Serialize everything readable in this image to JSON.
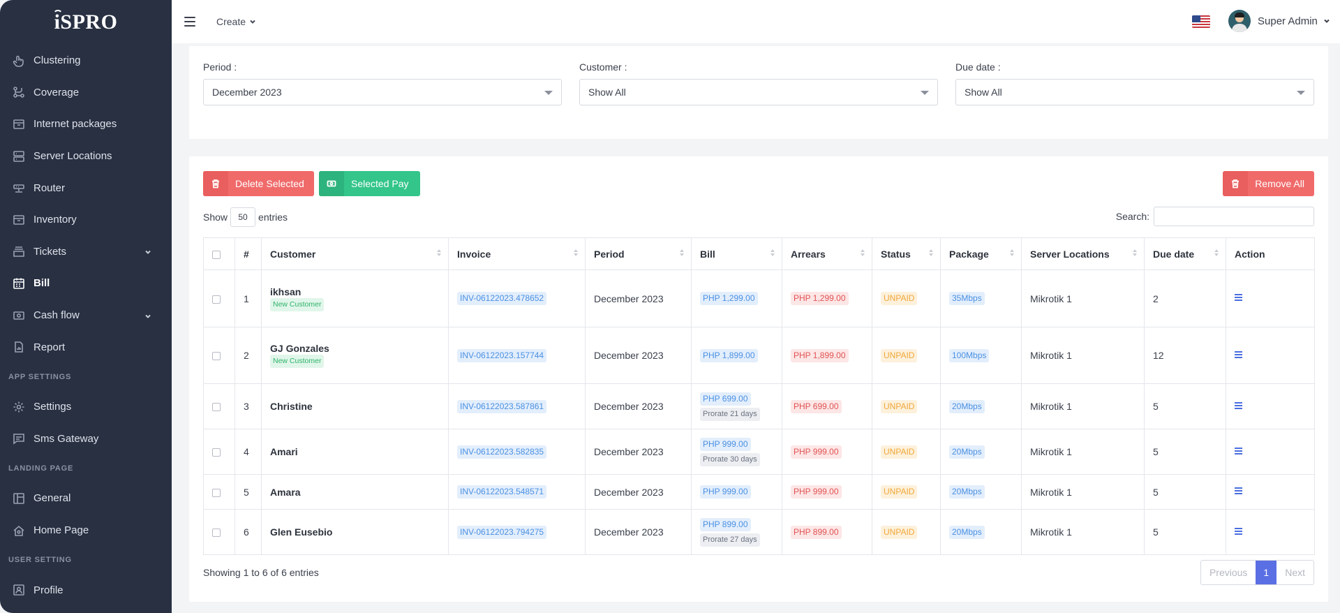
{
  "brand": {
    "name": "iSPRO"
  },
  "sidebar": {
    "items": [
      {
        "label": "Clustering",
        "icon": "hand-icon"
      },
      {
        "label": "Coverage",
        "icon": "route-icon"
      },
      {
        "label": "Internet packages",
        "icon": "archive-icon"
      },
      {
        "label": "Server Locations",
        "icon": "server-icon"
      },
      {
        "label": "Router",
        "icon": "router-icon"
      },
      {
        "label": "Inventory",
        "icon": "archive-icon"
      },
      {
        "label": "Tickets",
        "icon": "ticket-icon",
        "has_submenu": true
      },
      {
        "label": "Bill",
        "icon": "calendar-icon",
        "active": true
      },
      {
        "label": "Cash flow",
        "icon": "cash-icon",
        "has_submenu": true
      },
      {
        "label": "Report",
        "icon": "report-icon"
      }
    ],
    "sections": {
      "app_settings": "APP SETTINGS",
      "landing_page": "LANDING PAGE",
      "user_setting": "USER SETTING"
    },
    "app_settings_items": [
      {
        "label": "Settings",
        "icon": "gear-icon"
      },
      {
        "label": "Sms Gateway",
        "icon": "message-icon"
      }
    ],
    "landing_items": [
      {
        "label": "General",
        "icon": "layout-icon"
      },
      {
        "label": "Home Page",
        "icon": "home-icon"
      }
    ],
    "user_items": [
      {
        "label": "Profile",
        "icon": "profile-icon"
      }
    ]
  },
  "topbar": {
    "create_label": "Create",
    "user_name": "Super Admin",
    "flag": "us-flag-icon"
  },
  "filters": {
    "period": {
      "label": "Period :",
      "value": "December 2023"
    },
    "customer": {
      "label": "Customer :",
      "value": "Show All"
    },
    "due_date": {
      "label": "Due date :",
      "value": "Show All"
    }
  },
  "actions": {
    "delete_selected": "Delete Selected",
    "selected_pay": "Selected Pay",
    "remove_all": "Remove All"
  },
  "table_controls": {
    "show_label": "Show",
    "entries_value": "50",
    "entries_label": "entries",
    "search_label": "Search:"
  },
  "table": {
    "columns": [
      "#",
      "Customer",
      "Invoice",
      "Period",
      "Bill",
      "Arrears",
      "Status",
      "Package",
      "Server Locations",
      "Due date",
      "Action"
    ],
    "rows": [
      {
        "num": "1",
        "customer": "ikhsan",
        "tag": "New Customer",
        "invoice": "INV-06122023.478652",
        "period": "December 2023",
        "bill": "PHP 1,299.00",
        "prorate": "",
        "arrears": "PHP 1,299.00",
        "status": "UNPAID",
        "package": "35Mbps",
        "server": "Mikrotik 1",
        "due": "2"
      },
      {
        "num": "2",
        "customer": "GJ Gonzales",
        "tag": "New Customer",
        "invoice": "INV-06122023.157744",
        "period": "December 2023",
        "bill": "PHP 1,899.00",
        "prorate": "",
        "arrears": "PHP 1,899.00",
        "status": "UNPAID",
        "package": "100Mbps",
        "server": "Mikrotik 1",
        "due": "12"
      },
      {
        "num": "3",
        "customer": "Christine",
        "tag": "",
        "invoice": "INV-06122023.587861",
        "period": "December 2023",
        "bill": "PHP 699.00",
        "prorate": "Prorate 21 days",
        "arrears": "PHP 699.00",
        "status": "UNPAID",
        "package": "20Mbps",
        "server": "Mikrotik 1",
        "due": "5"
      },
      {
        "num": "4",
        "customer": "Amari",
        "tag": "",
        "invoice": "INV-06122023.582835",
        "period": "December 2023",
        "bill": "PHP 999.00",
        "prorate": "Prorate 30 days",
        "arrears": "PHP 999.00",
        "status": "UNPAID",
        "package": "20Mbps",
        "server": "Mikrotik 1",
        "due": "5"
      },
      {
        "num": "5",
        "customer": "Amara",
        "tag": "",
        "invoice": "INV-06122023.548571",
        "period": "December 2023",
        "bill": "PHP 999.00",
        "prorate": "",
        "arrears": "PHP 999.00",
        "status": "UNPAID",
        "package": "20Mbps",
        "server": "Mikrotik 1",
        "due": "5"
      },
      {
        "num": "6",
        "customer": "Glen Eusebio",
        "tag": "",
        "invoice": "INV-06122023.794275",
        "period": "December 2023",
        "bill": "PHP 899.00",
        "prorate": "Prorate 27 days",
        "arrears": "PHP 899.00",
        "status": "UNPAID",
        "package": "20Mbps",
        "server": "Mikrotik 1",
        "due": "5"
      }
    ]
  },
  "footer": {
    "showing": "Showing 1 to 6 of 6 entries",
    "previous": "Previous",
    "current_page": "1",
    "next": "Next"
  },
  "colors": {
    "sidebar_bg": "#283042",
    "danger": "#f06a6a",
    "success": "#33c58a",
    "primary": "#5a6fe3"
  }
}
